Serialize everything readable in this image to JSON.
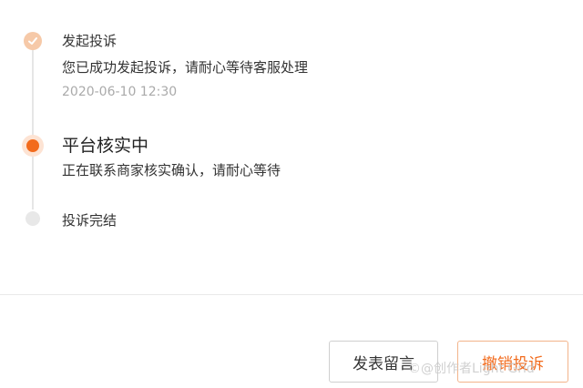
{
  "steps": [
    {
      "title": "发起投诉",
      "desc": "您已成功发起投诉，请耐心等待客服处理",
      "time": "2020-06-10 12:30",
      "status": "done"
    },
    {
      "title": "平台核实中",
      "desc": "正在联系商家核实确认，请耐心等待",
      "status": "active"
    },
    {
      "title": "投诉完结",
      "status": "pending"
    }
  ],
  "actions": {
    "leave_message": "发表留言",
    "cancel_complaint": "撤销投诉"
  },
  "watermark": "©@创作者Light Grid",
  "colors": {
    "accent": "#f26b1d",
    "done": "#f6c9a8",
    "pending": "#e8e8e8"
  },
  "icons": {
    "done_step": "check-icon"
  }
}
